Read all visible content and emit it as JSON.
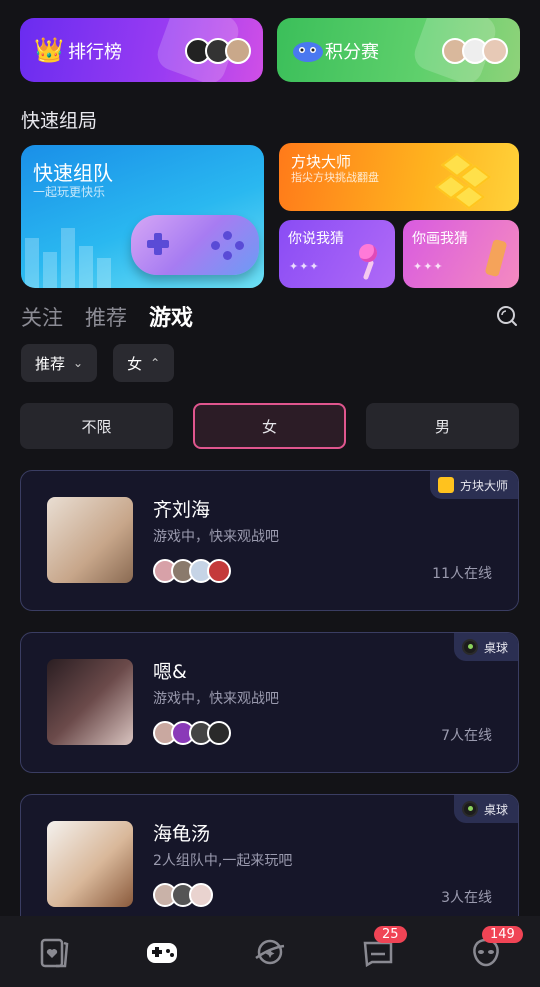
{
  "banners": {
    "rank": {
      "title": "排行榜",
      "icon": "crown-icon"
    },
    "points": {
      "title": "积分赛",
      "icon": "game-mascot-icon"
    }
  },
  "quick": {
    "section_title": "快速组局",
    "big": {
      "title": "快速组队",
      "subtitle": "一起玩更快乐"
    },
    "block": {
      "title": "方块大师",
      "subtitle": "指尖方块挑战翻盘"
    },
    "say": {
      "title": "你说我猜",
      "stars": "✦✦✦"
    },
    "draw": {
      "title": "你画我猜",
      "stars": "✦✦✦"
    }
  },
  "tabs": [
    {
      "label": "关注"
    },
    {
      "label": "推荐"
    },
    {
      "label": "游戏"
    }
  ],
  "filters": [
    {
      "label": "推荐",
      "chevron": "⌄"
    },
    {
      "label": "女",
      "chevron": "⌃"
    }
  ],
  "gender": [
    {
      "label": "不限"
    },
    {
      "label": "女"
    },
    {
      "label": "男"
    }
  ],
  "rooms": [
    {
      "name": "齐刘海",
      "status": "游戏中，快来观战吧",
      "online": "11人在线",
      "tag": "方块大师"
    },
    {
      "name": "嗯&",
      "status": "游戏中，快来观战吧",
      "online": "7人在线",
      "tag": "桌球"
    },
    {
      "name": "海龟汤",
      "status": "2人组队中,一起来玩吧",
      "online": "3人在线",
      "tag": "桌球"
    }
  ],
  "nav": {
    "badges": {
      "messages": "25",
      "profile": "149"
    }
  },
  "colors": {
    "accent_pink": "#e0568e",
    "background": "#131317",
    "badge_red": "#f04455"
  }
}
